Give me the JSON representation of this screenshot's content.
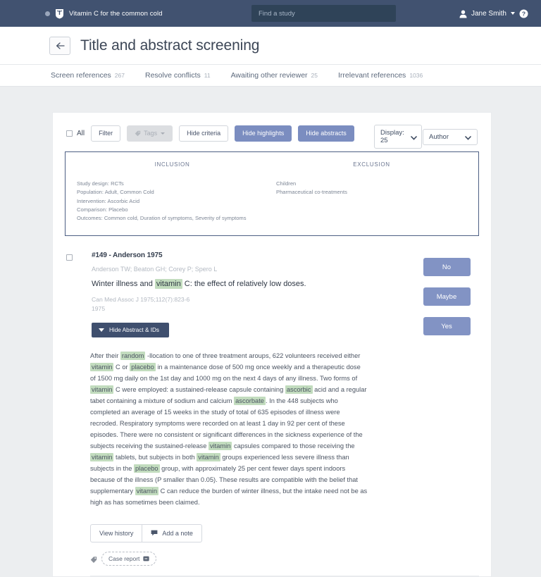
{
  "topnav": {
    "brand": "Vitamin C for the common cold",
    "brand_logo_icon": "shield-book-logo",
    "brand_dot_icon": "dot-icon",
    "search_placeholder": "Find a study",
    "search_value": "",
    "user_name": "Jane Smith",
    "user_icon": "person-icon",
    "caret_icon": "caret-down-icon",
    "help_icon": "help-circle-icon",
    "bg_color": "#415270"
  },
  "header": {
    "back_icon": "arrow-left-icon",
    "title": "Title and abstract screening"
  },
  "tabs": [
    {
      "label": "Screen references",
      "count": "267"
    },
    {
      "label": "Resolve conflicts",
      "count": "11"
    },
    {
      "label": "Awaiting other reviewer",
      "count": "25"
    },
    {
      "label": "Irrelevant references",
      "count": "1036"
    }
  ],
  "toolbar": {
    "all_label": "All",
    "filter_label": "Filter",
    "tags_label": "Tags",
    "tags_icon": "tag-icon",
    "hide_criteria_label": "Hide criteria",
    "hide_highlights_label": "Hide highlights",
    "hide_abstracts_label": "Hide abstracts",
    "display_select": "Display: 25",
    "sort_select": "Author",
    "chevron_icon": "chevron-down-icon",
    "primary_color": "#7b8dc0"
  },
  "criteria": {
    "inclusion_heading": "INCLUSION",
    "exclusion_heading": "EXCLUSION",
    "inclusion": [
      "Study design: RCTs",
      "Population: Adult, Common Cold",
      "Intervention: Ascorbic Acid",
      "Comparison: Placebo",
      "Outcomes: Common cold, Duration of symptoms, Severity of symptoms"
    ],
    "exclusion": [
      "Children",
      "Pharmaceutical co-treatments"
    ],
    "border_color": "#4d5f84"
  },
  "record": {
    "ref_id": "#149 - Anderson 1975",
    "authors": "Anderson TW; Beaton GH; Corey P; Spero L",
    "title_parts": [
      {
        "text": "Winter illness and ",
        "highlight": false
      },
      {
        "text": "vitamin",
        "highlight": true
      },
      {
        "text": " C: the effect of relatively low doses.",
        "highlight": false
      }
    ],
    "source": "Can Med Assoc J 1975;112(7):823-6",
    "year": "1975",
    "hide_abstract_label": "Hide Abstract & IDs",
    "toggle_icon": "triangle-down-icon",
    "checkbox_icon": "checkbox-unchecked-icon",
    "decisions": [
      {
        "label": "No"
      },
      {
        "label": "Maybe"
      },
      {
        "label": "Yes"
      }
    ],
    "decision_color": "#8293c4",
    "highlight_color": "#c2dcbe",
    "abstract_parts": [
      {
        "text": "After their ",
        "highlight": false
      },
      {
        "text": "random",
        "highlight": true
      },
      {
        "text": " -llocation to one of three treatment aroups, 622 volunteers received either ",
        "highlight": false
      },
      {
        "text": "vitamin",
        "highlight": true
      },
      {
        "text": " C or ",
        "highlight": false
      },
      {
        "text": "placebo",
        "highlight": true
      },
      {
        "text": " in a maintenance dose of 500 mg once weekly and a therapeutic dose of 1500 mg daily on the 1st day and 1000 mg on the next 4 days of any illness. Two forms of ",
        "highlight": false
      },
      {
        "text": "vitamin",
        "highlight": true
      },
      {
        "text": " C were employed: a sustained-release capsule containing ",
        "highlight": false
      },
      {
        "text": "ascorbic",
        "highlight": true
      },
      {
        "text": " acid and a regular tabet containing a mixture of sodium and calcium ",
        "highlight": false
      },
      {
        "text": "ascorbate",
        "highlight": true
      },
      {
        "text": ". In the 448 subjects who completed an average of 15 weeks in the study of total of 635 episodes of illness were recroded. Respiratory symptoms were recorded on at least 1 day in 92 per cent of these episodes. There were no consistent or significant differences in the sickness experience of the subjects receiving the sustained-release ",
        "highlight": false
      },
      {
        "text": "vitamin",
        "highlight": true
      },
      {
        "text": " capsules compared to those receiving the ",
        "highlight": false
      },
      {
        "text": "vitamin",
        "highlight": true
      },
      {
        "text": " tablets, but subjects in both ",
        "highlight": false
      },
      {
        "text": "vitamin",
        "highlight": true
      },
      {
        "text": " groups experienced less severe illness than subjects in the ",
        "highlight": false
      },
      {
        "text": "placebo",
        "highlight": true
      },
      {
        "text": " group, with approximately 25 per cent fewer days spent indoors because of the illness (P smaller than 0.05). These results are compatible with the belief that supplementary ",
        "highlight": false
      },
      {
        "text": "vitamin",
        "highlight": true
      },
      {
        "text": " C can reduce the burden of winter illness, but the intake need not be as high as has sometimes been claimed.",
        "highlight": false
      }
    ],
    "view_history_label": "View history",
    "add_note_label": "Add a note",
    "note_icon": "comment-icon",
    "tag_pin_icon": "tag-pin-icon",
    "tag_chip_label": "Case report",
    "tag_remove_icon": "remove-tag-icon"
  }
}
